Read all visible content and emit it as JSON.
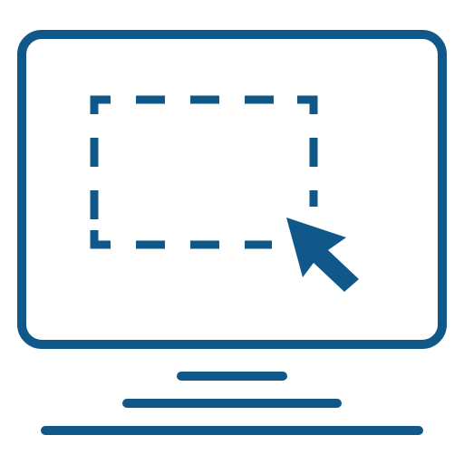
{
  "icon": {
    "name": "screen-selection-icon",
    "parts": [
      "monitor-frame-icon",
      "dashed-selection-rect-icon",
      "cursor-arrow-icon",
      "stand-bar-icon"
    ]
  },
  "colors": {
    "primary": "#10578a",
    "background": "#ffffff"
  }
}
